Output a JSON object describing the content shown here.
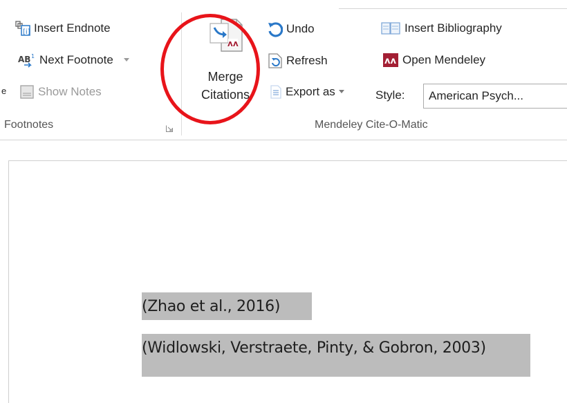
{
  "ribbon": {
    "footnotes_group": {
      "insert_endnote": "Insert Endnote",
      "next_footnote": "Next Footnote",
      "show_notes": "Show Notes",
      "label": "Footnotes",
      "left_cut_char": "e"
    },
    "mendeley_group": {
      "merge_citations_line1": "Merge",
      "merge_citations_line2": "Citations",
      "undo": "Undo",
      "refresh": "Refresh",
      "export_as": "Export as",
      "insert_bibliography": "Insert Bibliography",
      "open_mendeley": "Open Mendeley",
      "style_label": "Style:",
      "style_value": "American Psych...",
      "label": "Mendeley Cite-O-Matic"
    }
  },
  "document": {
    "citations": [
      "(Zhao et al., 2016)",
      "(Widlowski, Verstraete, Pinty, & Gobron, 2003)"
    ]
  },
  "colors": {
    "highlight_circle": "#e8141a",
    "mendeley_red": "#a31f34",
    "undo_blue": "#2a78c8",
    "selection_gray": "#bcbcbc"
  },
  "icons": {
    "insert_endnote": "endnote-icon",
    "next_footnote": "next-footnote-icon",
    "show_notes": "notes-icon",
    "merge_citations": "merge-citations-icon",
    "undo": "undo-icon",
    "refresh": "refresh-icon",
    "export_as": "export-icon",
    "insert_bibliography": "bibliography-icon",
    "open_mendeley": "mendeley-icon"
  }
}
